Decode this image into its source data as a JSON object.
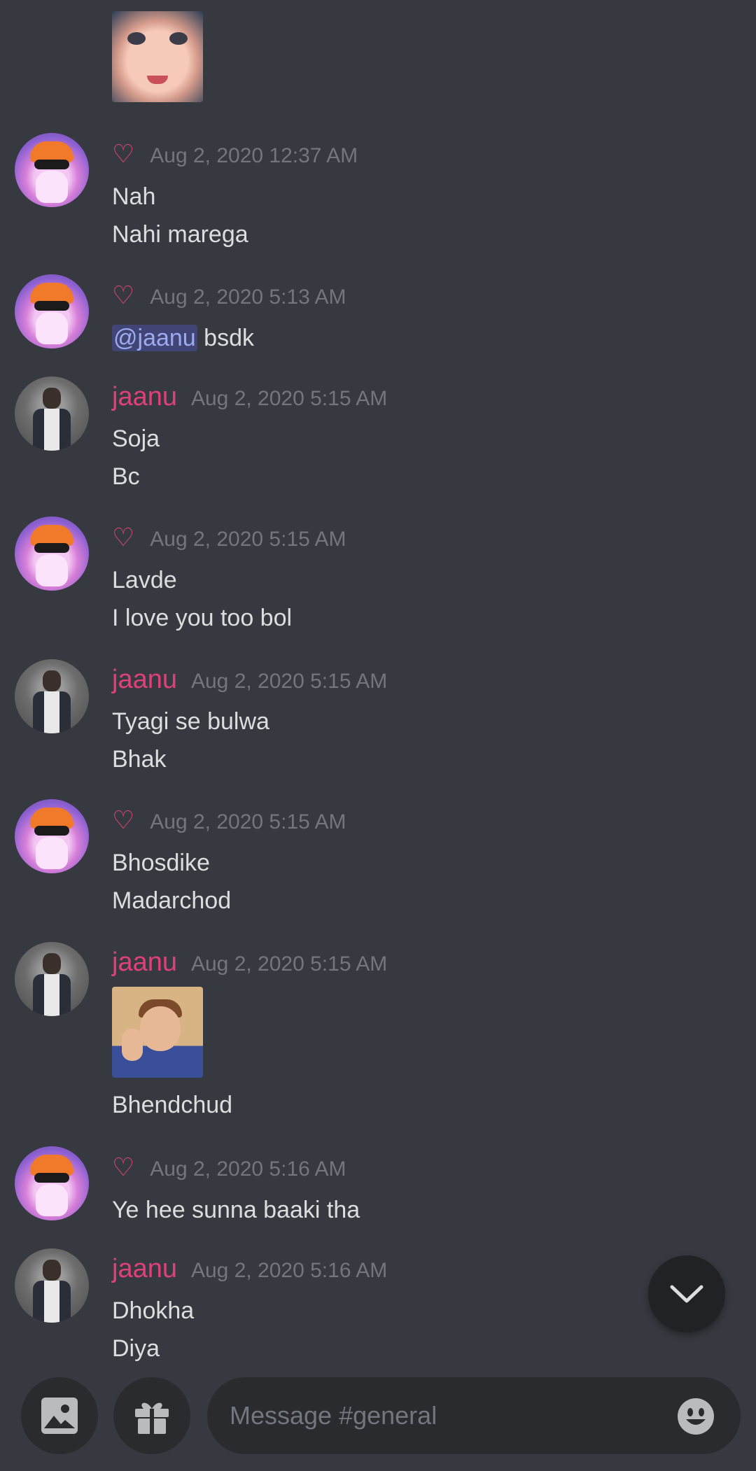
{
  "composer": {
    "placeholder": "Message #general"
  },
  "author_heart": {
    "glyph": "♡",
    "color": "#e8447a"
  },
  "username_color": "#e0407a",
  "messages": [
    {
      "author": "♡",
      "timestamp": "Aug 2, 2020 12:37 AM",
      "lines": [
        "Nah",
        "Nahi marega"
      ]
    },
    {
      "author": "♡",
      "timestamp": "Aug 2, 2020 5:13 AM",
      "mention": "@jaanu",
      "text_after_mention": "bsdk"
    },
    {
      "author": "jaanu",
      "timestamp": "Aug 2, 2020 5:15 AM",
      "lines": [
        "Soja",
        "Bc"
      ]
    },
    {
      "author": "♡",
      "timestamp": "Aug 2, 2020 5:15 AM",
      "lines": [
        "Lavde",
        "I love you too bol"
      ]
    },
    {
      "author": "jaanu",
      "timestamp": "Aug 2, 2020 5:15 AM",
      "lines": [
        "Tyagi se bulwa",
        "Bhak"
      ]
    },
    {
      "author": "♡",
      "timestamp": "Aug 2, 2020 5:15 AM",
      "lines": [
        "Bhosdike",
        "Madarchod"
      ]
    },
    {
      "author": "jaanu",
      "timestamp": "Aug 2, 2020 5:15 AM",
      "lines": [
        "Bhendchud"
      ]
    },
    {
      "author": "♡",
      "timestamp": "Aug 2, 2020 5:16 AM",
      "lines": [
        "Ye hee sunna baaki tha"
      ]
    },
    {
      "author": "jaanu",
      "timestamp": "Aug 2, 2020 5:16 AM",
      "lines": [
        "Dhokha",
        "Diya"
      ]
    }
  ],
  "icons": {
    "scroll_down": "chevron-down-icon",
    "attach_image": "image-icon",
    "gift": "gift-icon",
    "emoji": "emoji-icon"
  }
}
